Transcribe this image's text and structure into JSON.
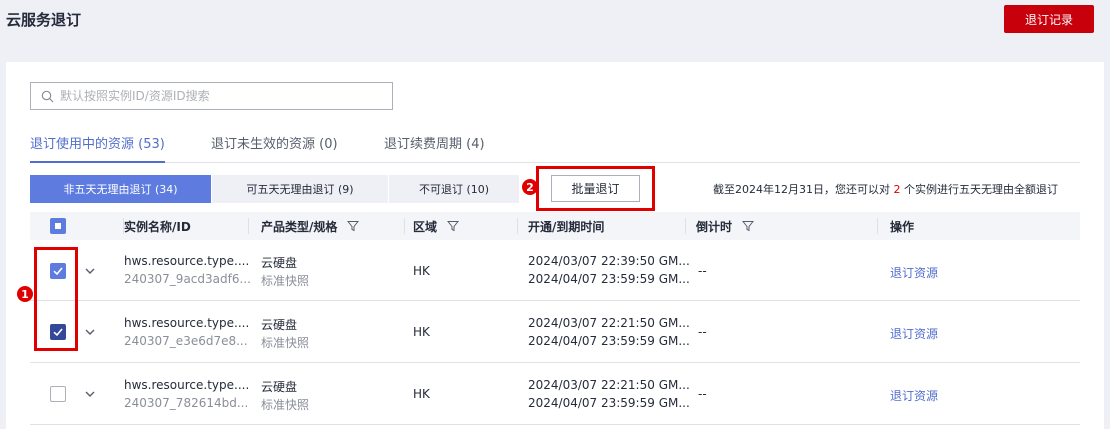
{
  "header": {
    "title": "云服务退订",
    "records_button": "退订记录"
  },
  "search": {
    "placeholder": "默认按照实例ID/资源ID搜索"
  },
  "tabs": [
    {
      "label": "退订使用中的资源 (53)",
      "active": true
    },
    {
      "label": "退订未生效的资源 (0)",
      "active": false
    },
    {
      "label": "退订续费周期 (4)",
      "active": false
    }
  ],
  "filters": [
    {
      "label": "非五天无理由退订 (34)",
      "active": true
    },
    {
      "label": "可五天无理由退订 (9)",
      "active": false
    },
    {
      "label": "不可退订 (10)",
      "active": false
    }
  ],
  "batch_button": "批量退订",
  "notice": {
    "prefix": "截至2024年12月31日，您还可以对",
    "count": "2",
    "suffix": "个实例进行五天无理由全额退订"
  },
  "annotations": [
    "1",
    "2"
  ],
  "columns": {
    "name": "实例名称/ID",
    "type": "产品类型/规格",
    "region": "区域",
    "time": "开通/到期时间",
    "countdown": "倒计时",
    "action": "操作"
  },
  "rows": [
    {
      "name": "hws.resource.type....",
      "id": "240307_9acd3adf6...",
      "product": "云硬盘",
      "spec": "标准快照",
      "region": "HK",
      "start": "2024/03/07 22:39:50 GM...",
      "end": "2024/04/07 23:59:59 GM...",
      "countdown": "--",
      "action": "退订资源",
      "checked": true
    },
    {
      "name": "hws.resource.type....",
      "id": "240307_e3e6d7e8...",
      "product": "云硬盘",
      "spec": "标准快照",
      "region": "HK",
      "start": "2024/03/07 22:21:50 GM...",
      "end": "2024/04/07 23:59:59 GM...",
      "countdown": "--",
      "action": "退订资源",
      "checked": true
    },
    {
      "name": "hws.resource.type....",
      "id": "240307_782614bd...",
      "product": "云硬盘",
      "spec": "标准快照",
      "region": "HK",
      "start": "2024/03/07 22:21:50 GM...",
      "end": "2024/04/07 23:59:59 GM...",
      "countdown": "--",
      "action": "退订资源",
      "checked": false
    }
  ],
  "colors": {
    "brand_red": "#c7000b",
    "primary_blue": "#5e7ce0",
    "link_blue": "#526ecc",
    "annotation_red": "#e00000"
  }
}
